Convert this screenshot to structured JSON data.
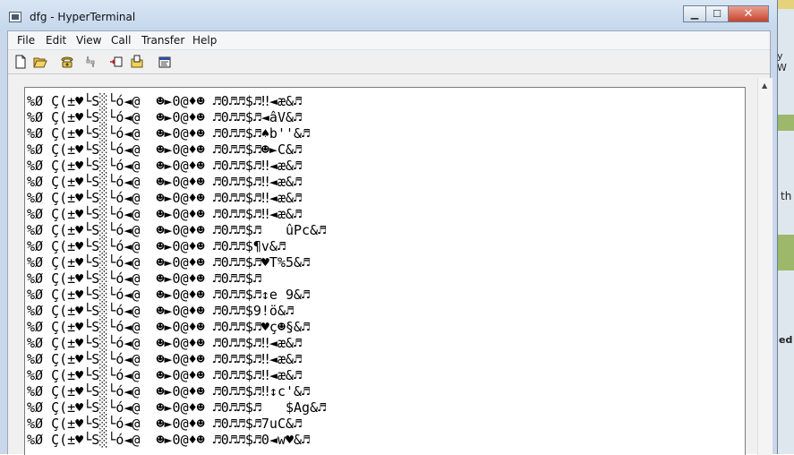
{
  "window": {
    "title": "dfg - HyperTerminal"
  },
  "desktop": {
    "text_1": "y W",
    "text_2": "th",
    "text_3": "ed"
  },
  "menu": [
    "File",
    "Edit",
    "View",
    "Call",
    "Transfer",
    "Help"
  ],
  "toolbar": [
    "new-document-icon",
    "open-folder-icon",
    "phone-call-icon",
    "disconnect-icon",
    "send-file-icon",
    "receive-file-icon",
    "properties-icon"
  ],
  "terminal": {
    "lines": [
      "%Ø Ç(±♥└S░└ó◄@  ☻►0@♦☻ ♬0♬♬$♬‼◄æ&♬",
      "%Ø Ç(±♥└S░└ó◄@  ☻►0@♦☻ ♬0♬♬$♬◄âV&♬",
      "%Ø Ç(±♥└S░└ó◄@  ☻►0@♦☻ ♬0♬♬$♬♠b''&♬",
      "%Ø Ç(±♥└S░└ó◄@  ☻►0@♦☻ ♬0♬♬$♬☻►C&♬",
      "%Ø Ç(±♥└S░└ó◄@  ☻►0@♦☻ ♬0♬♬$♬‼◄æ&♬",
      "%Ø Ç(±♥└S░└ó◄@  ☻►0@♦☻ ♬0♬♬$♬‼◄æ&♬",
      "%Ø Ç(±♥└S░└ó◄@  ☻►0@♦☻ ♬0♬♬$♬‼◄æ&♬",
      "%Ø Ç(±♥└S░└ó◄@  ☻►0@♦☻ ♬0♬♬$♬‼◄æ&♬",
      "%Ø Ç(±♥└S░└ó◄@  ☻►0@♦☻ ♬0♬♬$♬   ûPc&♬",
      "%Ø Ç(±♥└S░└ó◄@  ☻►0@♦☻ ♬0♬♬$¶v&♬",
      "%Ø Ç(±♥└S░└ó◄@  ☻►0@♦☻ ♬0♬♬$♬♥T%5&♬",
      "%Ø Ç(±♥└S░└ó◄@  ☻►0@♦☻ ♬0♬♬$♬",
      "%Ø Ç(±♥└S░└ó◄@  ☻►0@♦☻ ♬0♬♬$♬↕e 9&♬",
      "%Ø Ç(±♥└S░└ó◄@  ☻►0@♦☻ ♬0♬♬$9!ö&♬",
      "%Ø Ç(±♥└S░└ó◄@  ☻►0@♦☻ ♬0♬♬$♬♥ç☻§&♬",
      "%Ø Ç(±♥└S░└ó◄@  ☻►0@♦☻ ♬0♬♬$♬‼◄æ&♬",
      "%Ø Ç(±♥└S░└ó◄@  ☻►0@♦☻ ♬0♬♬$♬‼◄æ&♬",
      "%Ø Ç(±♥└S░└ó◄@  ☻►0@♦☻ ♬0♬♬$♬‼◄æ&♬",
      "%Ø Ç(±♥└S░└ó◄@  ☻►0@♦☻ ♬0♬♬$♬‼↕c'&♬",
      "%Ø Ç(±♥└S░└ó◄@  ☻►0@♦☻ ♬0♬♬$♬   $Ag&♬",
      "%Ø Ç(±♥└S░└ó◄@  ☻►0@♦☻ ♬0♬♬$♬7uC&♬",
      "%Ø Ç(±♥└S░└ó◄@  ☻►0@♦☻ ♬0♬♬$♬0◄w♥&♬"
    ]
  }
}
